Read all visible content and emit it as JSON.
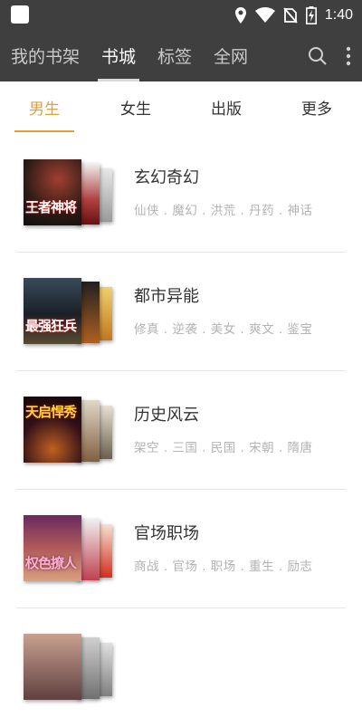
{
  "status_bar": {
    "time": "1:40",
    "icons": [
      "location-icon",
      "wifi-icon",
      "no-sim-icon",
      "battery-charging-icon"
    ]
  },
  "top_nav": {
    "tabs": [
      {
        "label": "我的书架",
        "active": false
      },
      {
        "label": "书城",
        "active": true
      },
      {
        "label": "标签",
        "active": false
      },
      {
        "label": "全网",
        "active": false
      }
    ],
    "actions": [
      "search-icon",
      "more-vertical-icon"
    ]
  },
  "sub_tabs": [
    {
      "label": "男生",
      "active": true
    },
    {
      "label": "女生",
      "active": false
    },
    {
      "label": "出版",
      "active": false
    },
    {
      "label": "更多",
      "active": false
    }
  ],
  "categories": [
    {
      "title": "玄幻奇幻",
      "tags": "仙侠 . 魔幻 . 洪荒 . 丹药 . 神话",
      "cover_text": "王者神将"
    },
    {
      "title": "都市异能",
      "tags": "修真 . 逆袭 . 美女 . 爽文 . 鉴宝",
      "cover_text": "最强狂兵"
    },
    {
      "title": "历史风云",
      "tags": "架空 . 三国 . 民国 . 宋朝 . 隋唐",
      "cover_text": "天启悍秀"
    },
    {
      "title": "官场职场",
      "tags": "商战 . 官场 . 职场 . 重生 . 励志",
      "cover_text": "权色撩人"
    },
    {
      "title": "",
      "tags": "",
      "cover_text": ""
    }
  ],
  "colors": {
    "bar": "#3f3f3f",
    "accent": "#e2a03a",
    "muted_tag": "#b3b3b3"
  }
}
